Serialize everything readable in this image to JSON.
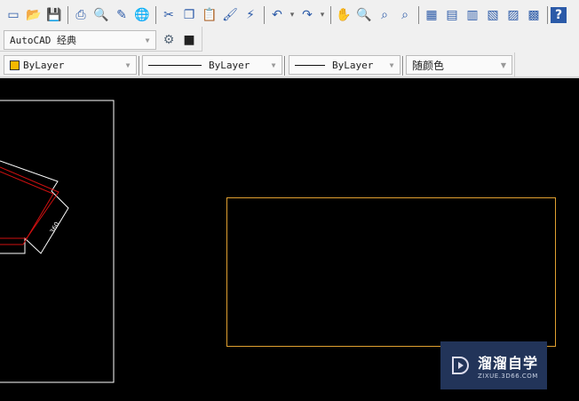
{
  "toolbar": {
    "icons": [
      {
        "name": "new-icon",
        "g": "▭"
      },
      {
        "name": "open-icon",
        "g": "📂"
      },
      {
        "name": "save-icon",
        "g": "💾"
      },
      {
        "sep": true
      },
      {
        "name": "plot-icon",
        "g": "⎙"
      },
      {
        "name": "plot-preview-icon",
        "g": "🔍"
      },
      {
        "name": "publish-icon",
        "g": "✎"
      },
      {
        "name": "3d-dwf-icon",
        "g": "🌐"
      },
      {
        "sep": true
      },
      {
        "name": "cut-icon",
        "g": "✂"
      },
      {
        "name": "copy-icon",
        "g": "❐"
      },
      {
        "name": "paste-icon",
        "g": "📋"
      },
      {
        "name": "match-properties-icon",
        "g": "🖌"
      },
      {
        "name": "block-editor-icon",
        "g": "⚡"
      },
      {
        "sep": true
      },
      {
        "name": "undo-icon",
        "g": "↶"
      },
      {
        "name": "undo-dropdown-icon",
        "g": "▾"
      },
      {
        "name": "redo-icon",
        "g": "↷"
      },
      {
        "name": "redo-dropdown-icon",
        "g": "▾"
      },
      {
        "sep": true
      },
      {
        "name": "pan-icon",
        "g": "✋"
      },
      {
        "name": "zoom-realtime-icon",
        "g": "🔍"
      },
      {
        "name": "zoom-window-icon",
        "g": "⌕"
      },
      {
        "name": "zoom-previous-icon",
        "g": "⌕"
      },
      {
        "sep": true
      },
      {
        "name": "properties-icon",
        "g": "▦"
      },
      {
        "name": "design-center-icon",
        "g": "▤"
      },
      {
        "name": "tool-palettes-icon",
        "g": "▥"
      },
      {
        "name": "sheet-set-icon",
        "g": "▧"
      },
      {
        "name": "markup-icon",
        "g": "▨"
      },
      {
        "name": "calculator-icon",
        "g": "▩"
      },
      {
        "sep": true
      },
      {
        "name": "help-icon",
        "g": "?"
      }
    ]
  },
  "workspace": {
    "value": "AutoCAD 经典"
  },
  "properties": {
    "color": "ByLayer",
    "linetype": "ByLayer",
    "lineweight": "ByLayer",
    "plotstyle": "随颜色"
  },
  "colors": {
    "layer_color": "#f5b800",
    "rect": "#e0a030",
    "red": "#d01010"
  },
  "watermark": {
    "title": "溜溜自学",
    "subtitle": "ZIXUE.3D66.COM"
  },
  "drawing": {
    "dimension_text": "360"
  }
}
